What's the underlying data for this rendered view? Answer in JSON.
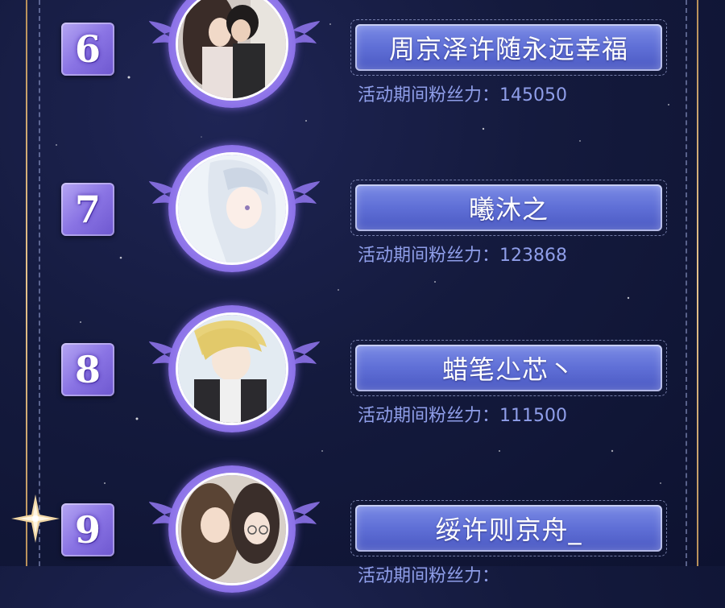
{
  "rankings": [
    {
      "rank": "6",
      "name": "周京泽许随永远幸福",
      "fans_label": "活动期间粉丝力：",
      "fans_value": "145050"
    },
    {
      "rank": "7",
      "name": "曦沐之",
      "fans_label": "活动期间粉丝力：",
      "fans_value": "123868"
    },
    {
      "rank": "8",
      "name": "蜡笔尐芯丶",
      "fans_label": "活动期间粉丝力：",
      "fans_value": "111500"
    },
    {
      "rank": "9",
      "name": "绥许则京舟_",
      "fans_label": "活动期间粉丝力：",
      "fans_value": ""
    }
  ],
  "colors": {
    "background": "#141a3d",
    "badge": "#8a74e4",
    "pill": "#5f6fd6",
    "fans_text": "#8f9ee9",
    "frame_gold": "#e6c38c"
  },
  "icons": {
    "wings": "angel-wings-icon",
    "sparkle": "four-point-star-icon"
  }
}
